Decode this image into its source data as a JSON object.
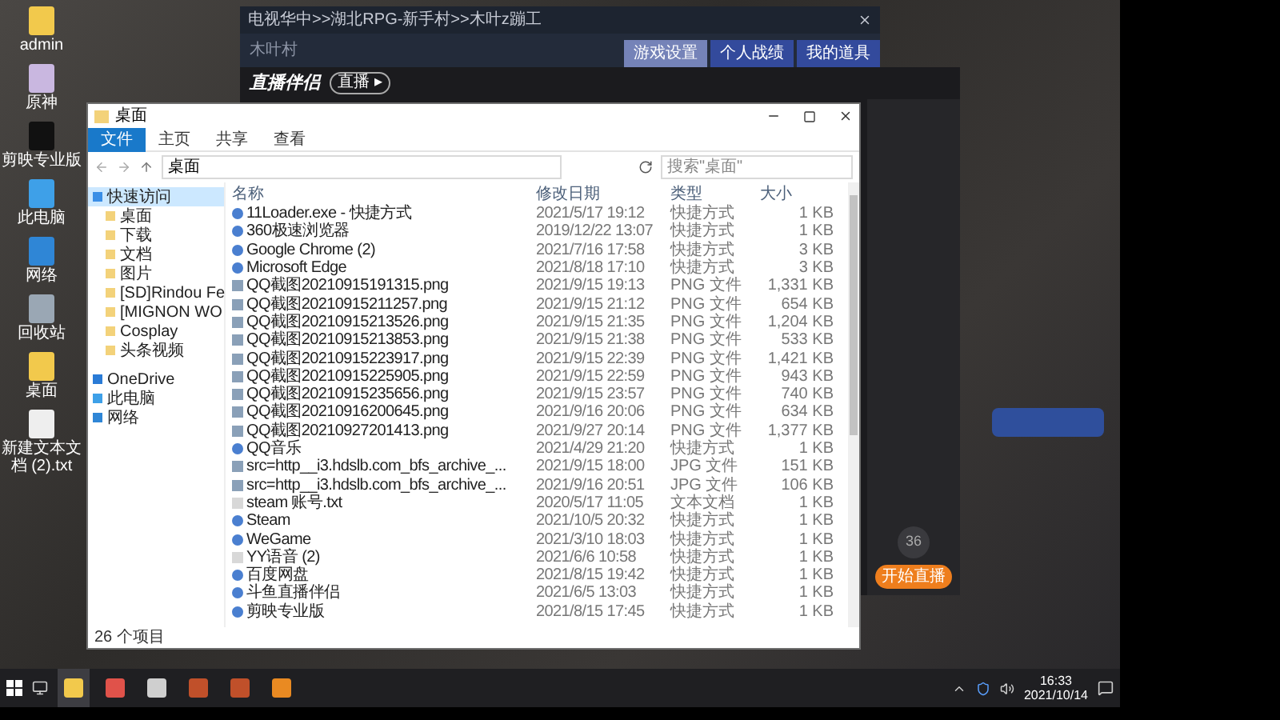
{
  "desktop_icons": [
    {
      "label": "admin",
      "kind": "folder"
    },
    {
      "label": "原神",
      "kind": "game"
    },
    {
      "label": "剪映专业版",
      "kind": "editor"
    },
    {
      "label": "此电脑",
      "kind": "computer"
    },
    {
      "label": "网络",
      "kind": "network"
    },
    {
      "label": "回收站",
      "kind": "recycle"
    },
    {
      "label": "桌面",
      "kind": "folder"
    },
    {
      "label": "新建文本文档 (2).txt",
      "kind": "text"
    }
  ],
  "game_window": {
    "title": "电视华中>>湖北RPG-新手村>>木叶z蹦工",
    "location": "木叶村",
    "tabs": [
      {
        "label": "游戏设置",
        "selected": true
      },
      {
        "label": "个人战绩",
        "selected": false
      },
      {
        "label": "我的道具",
        "selected": false
      }
    ]
  },
  "streaming_app": {
    "logo": "直播伴侣",
    "pill": "直播 ▸",
    "start_button": "开始直播",
    "counter": "36"
  },
  "explorer": {
    "title": "桌面",
    "ribbon_tabs": [
      {
        "label": "文件",
        "selected": true
      },
      {
        "label": "主页",
        "selected": false
      },
      {
        "label": "共享",
        "selected": false
      },
      {
        "label": "查看",
        "selected": false
      }
    ],
    "path": "桌面",
    "search": {
      "placeholder": "搜索\"桌面\""
    },
    "nav": [
      {
        "label": "快速访问",
        "kind": "star",
        "selected": true
      },
      {
        "label": "桌面",
        "kind": "folder",
        "selected": false
      },
      {
        "label": "下载",
        "kind": "folder",
        "selected": false
      },
      {
        "label": "文档",
        "kind": "folder",
        "selected": false
      },
      {
        "label": "图片",
        "kind": "folder",
        "selected": false
      },
      {
        "label": "[SD]Rindou Fe",
        "kind": "folder",
        "selected": false
      },
      {
        "label": "[MIGNON WO",
        "kind": "folder",
        "selected": false
      },
      {
        "label": "Cosplay",
        "kind": "folder",
        "selected": false
      },
      {
        "label": "头条视频",
        "kind": "folder",
        "selected": false
      },
      {
        "label": "OneDrive",
        "kind": "cloud",
        "selected": false
      },
      {
        "label": "此电脑",
        "kind": "computer",
        "selected": false
      },
      {
        "label": "网络",
        "kind": "network",
        "selected": false
      }
    ],
    "columns": [
      "名称",
      "修改日期",
      "类型",
      "大小"
    ],
    "rows": [
      {
        "name": "11Loader.exe - 快捷方式",
        "date": "2021/5/17 19:12",
        "type": "快捷方式",
        "size": "1 KB",
        "kind": "shortcut"
      },
      {
        "name": "360极速浏览器",
        "date": "2019/12/22 13:07",
        "type": "快捷方式",
        "size": "1 KB",
        "kind": "shortcut"
      },
      {
        "name": "Google Chrome (2)",
        "date": "2021/7/16 17:58",
        "type": "快捷方式",
        "size": "3 KB",
        "kind": "shortcut"
      },
      {
        "name": "Microsoft Edge",
        "date": "2021/8/18 17:10",
        "type": "快捷方式",
        "size": "3 KB",
        "kind": "shortcut"
      },
      {
        "name": "QQ截图20210915191315.png",
        "date": "2021/9/15 19:13",
        "type": "PNG 文件",
        "size": "1,331 KB",
        "kind": "image"
      },
      {
        "name": "QQ截图20210915211257.png",
        "date": "2021/9/15 21:12",
        "type": "PNG 文件",
        "size": "654 KB",
        "kind": "image"
      },
      {
        "name": "QQ截图20210915213526.png",
        "date": "2021/9/15 21:35",
        "type": "PNG 文件",
        "size": "1,204 KB",
        "kind": "image"
      },
      {
        "name": "QQ截图20210915213853.png",
        "date": "2021/9/15 21:38",
        "type": "PNG 文件",
        "size": "533 KB",
        "kind": "image"
      },
      {
        "name": "QQ截图20210915223917.png",
        "date": "2021/9/15 22:39",
        "type": "PNG 文件",
        "size": "1,421 KB",
        "kind": "image"
      },
      {
        "name": "QQ截图20210915225905.png",
        "date": "2021/9/15 22:59",
        "type": "PNG 文件",
        "size": "943 KB",
        "kind": "image"
      },
      {
        "name": "QQ截图20210915235656.png",
        "date": "2021/9/15 23:57",
        "type": "PNG 文件",
        "size": "740 KB",
        "kind": "image"
      },
      {
        "name": "QQ截图20210916200645.png",
        "date": "2021/9/16 20:06",
        "type": "PNG 文件",
        "size": "634 KB",
        "kind": "image"
      },
      {
        "name": "QQ截图20210927201413.png",
        "date": "2021/9/27 20:14",
        "type": "PNG 文件",
        "size": "1,377 KB",
        "kind": "image"
      },
      {
        "name": "QQ音乐",
        "date": "2021/4/29 21:20",
        "type": "快捷方式",
        "size": "1 KB",
        "kind": "shortcut"
      },
      {
        "name": "src=http__i3.hdslb.com_bfs_archive_...",
        "date": "2021/9/15 18:00",
        "type": "JPG 文件",
        "size": "151 KB",
        "kind": "image"
      },
      {
        "name": "src=http__i3.hdslb.com_bfs_archive_...",
        "date": "2021/9/16 20:51",
        "type": "JPG 文件",
        "size": "106 KB",
        "kind": "image"
      },
      {
        "name": "steam 账号.txt",
        "date": "2020/5/17 11:05",
        "type": "文本文档",
        "size": "1 KB",
        "kind": "text"
      },
      {
        "name": "Steam",
        "date": "2021/10/5 20:32",
        "type": "快捷方式",
        "size": "1 KB",
        "kind": "shortcut"
      },
      {
        "name": "WeGame",
        "date": "2021/3/10 18:03",
        "type": "快捷方式",
        "size": "1 KB",
        "kind": "shortcut"
      },
      {
        "name": "YY语音 (2)",
        "date": "2021/6/6 10:58",
        "type": "快捷方式",
        "size": "1 KB",
        "kind": "text"
      },
      {
        "name": "百度网盘",
        "date": "2021/8/15 19:42",
        "type": "快捷方式",
        "size": "1 KB",
        "kind": "shortcut"
      },
      {
        "name": "斗鱼直播伴侣",
        "date": "2021/6/5 13:03",
        "type": "快捷方式",
        "size": "1 KB",
        "kind": "shortcut"
      },
      {
        "name": "剪映专业版",
        "date": "2021/8/15 17:45",
        "type": "快捷方式",
        "size": "1 KB",
        "kind": "shortcut"
      }
    ],
    "status": "26 个项目"
  },
  "taskbar": {
    "apps": [
      {
        "kind": "explorer",
        "selected": true
      },
      {
        "kind": "browser",
        "selected": false
      },
      {
        "kind": "globe",
        "selected": false
      },
      {
        "kind": "game",
        "selected": false
      },
      {
        "kind": "game",
        "selected": false
      },
      {
        "kind": "orange",
        "selected": false
      }
    ],
    "time": "16:33",
    "date": "2021/10/14"
  }
}
